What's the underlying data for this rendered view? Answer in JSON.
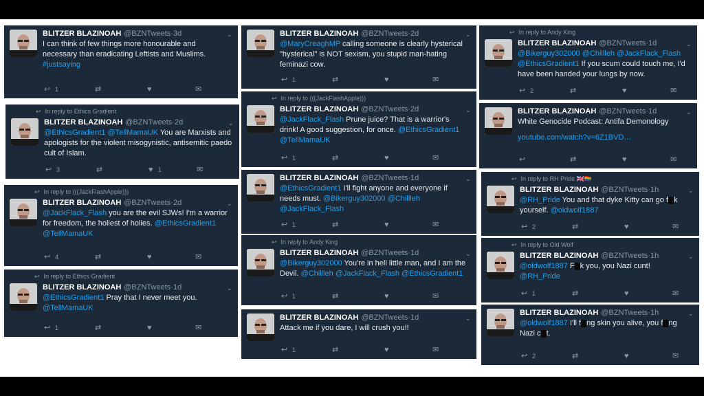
{
  "name": "BLITZER BLAZINOAH",
  "handle": "@BZNTweets",
  "tweets": [
    {
      "time": "3d",
      "reply": "",
      "segments": [
        {
          "t": "I can think of few things more honourable and necessary than eradicating Leftists and Muslims. "
        },
        {
          "t": "#justsaying",
          "link": true
        }
      ],
      "reply_count": "1",
      "likes": ""
    },
    {
      "time": "2d",
      "reply": "In reply to Ethics Gradient",
      "segments": [
        {
          "t": "@EthicsGradient1 @TellMamaUK",
          "link": true
        },
        {
          "t": " You are Marxists and apologists for the violent misogynistic, antisemitic paedo cult of Islam."
        }
      ],
      "reply_count": "3",
      "likes": "1"
    },
    {
      "time": "2d",
      "reply": "In reply to (((JackFlashApple)))",
      "segments": [
        {
          "t": "@JackFlack_Flash",
          "link": true
        },
        {
          "t": " you are the evil SJWs! I'm a warrior for freedom, the holiest of holies. "
        },
        {
          "t": "@EthicsGradient1 @TellMamaUK",
          "link": true
        }
      ],
      "reply_count": "4",
      "likes": ""
    },
    {
      "time": "1d",
      "reply": "In reply to Ethics Gradient",
      "segments": [
        {
          "t": "@EthicsGradient1",
          "link": true
        },
        {
          "t": " Pray that I never meet you. "
        },
        {
          "t": "@TellMamaUK",
          "link": true
        }
      ],
      "reply_count": "1",
      "likes": ""
    },
    {
      "time": "2d",
      "reply": "",
      "segments": [
        {
          "t": "@MaryCreaghMP",
          "link": true
        },
        {
          "t": " calling someone is clearly hysterical \"hysterical\" is NOT sexism, you stupid man-hating feminazi cow."
        }
      ],
      "reply_count": "1",
      "likes": ""
    },
    {
      "time": "2d",
      "reply": "In reply to (((JackFlashApple)))",
      "segments": [
        {
          "t": "@JackFlack_Flash",
          "link": true
        },
        {
          "t": " Prune juice? That is a warrior's drink! A good suggestion, for once. "
        },
        {
          "t": "@EthicsGradient1 @TellMamaUK",
          "link": true
        }
      ],
      "reply_count": "1",
      "likes": ""
    },
    {
      "time": "1d",
      "reply": "",
      "segments": [
        {
          "t": "@EthicsGradient1",
          "link": true
        },
        {
          "t": " I'll fight anyone and everyone if needs must. "
        },
        {
          "t": "@Bikerguy302000 @Chillleh @JackFlack_Flash",
          "link": true
        }
      ],
      "reply_count": "1",
      "likes": ""
    },
    {
      "time": "1d",
      "reply": "In reply to Andy  King",
      "segments": [
        {
          "t": "@Bikerguy302000",
          "link": true
        },
        {
          "t": " You're in hell little man, and I am the Devil. "
        },
        {
          "t": "@Chillleh @JackFlack_Flash @EthicsGradient1",
          "link": true
        }
      ],
      "reply_count": "1",
      "likes": ""
    },
    {
      "time": "1d",
      "reply": "",
      "segments": [
        {
          "t": "Attack me if you dare, I will crush you!!"
        }
      ],
      "reply_count": "1",
      "likes": ""
    },
    {
      "time": "1d",
      "reply": "In reply to Andy  King",
      "segments": [
        {
          "t": "@Bikerguy302000 @Chillleh @JackFlack_Flash @EthicsGradient1",
          "link": true
        },
        {
          "t": " If you scum could touch me, I'd have been handed your lungs by now."
        }
      ],
      "reply_count": "2",
      "likes": ""
    },
    {
      "time": "1d",
      "reply": "",
      "segments": [
        {
          "t": "White Genocide Podcast: Antifa Demonology"
        },
        {
          "t": "youtube.com/watch?v=6Z1BVD…",
          "link": true,
          "block": true
        }
      ],
      "reply_count": "",
      "likes": ""
    },
    {
      "time": "1h",
      "reply": "In reply to RH Pride 🇬🇧🏳️‍🌈",
      "segments": [
        {
          "t": "@RH_Pride",
          "link": true
        },
        {
          "t": " You and that dyke Kitty can go f"
        },
        {
          "red": true
        },
        {
          "t": "k yourself. "
        },
        {
          "t": "@oldwolf1887",
          "link": true
        }
      ],
      "reply_count": "2",
      "likes": ""
    },
    {
      "time": "1h",
      "reply": "In reply to Old Wolf",
      "segments": [
        {
          "t": "@oldwolf1887",
          "link": true
        },
        {
          "t": " F"
        },
        {
          "red": true
        },
        {
          "t": "k you, you Nazi cunt! "
        },
        {
          "t": "@RH_Pride",
          "link": true
        }
      ],
      "reply_count": "1",
      "likes": ""
    },
    {
      "time": "1h",
      "reply": "",
      "segments": [
        {
          "t": "@oldwolf1887",
          "link": true
        },
        {
          "t": " I'll f"
        },
        {
          "red": true
        },
        {
          "t": "ng skin you alive, you f"
        },
        {
          "red": true
        },
        {
          "t": "ng Nazi c"
        },
        {
          "red": true
        },
        {
          "t": "t."
        }
      ],
      "reply_count": "2",
      "likes": ""
    }
  ]
}
